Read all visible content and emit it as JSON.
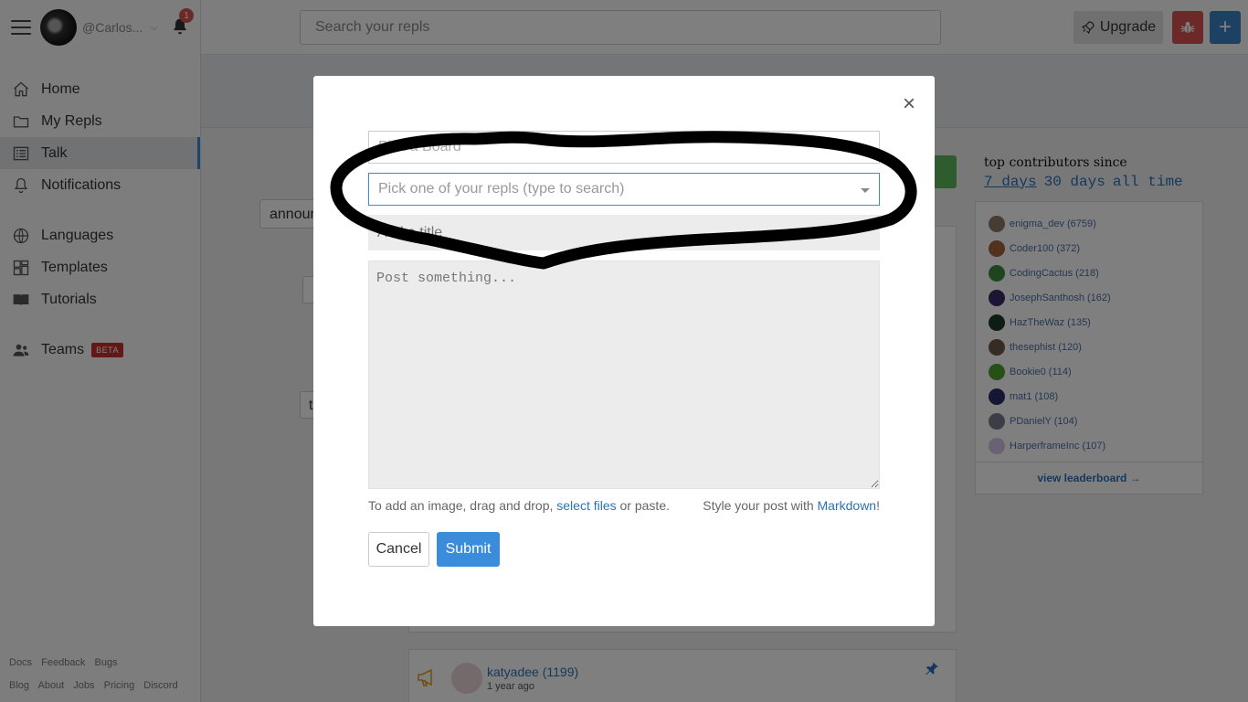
{
  "sidebar": {
    "username": "@Carlos...",
    "notification_count": "1",
    "items": [
      {
        "label": "Home",
        "icon": "home-icon"
      },
      {
        "label": "My Repls",
        "icon": "folder-icon"
      },
      {
        "label": "Talk",
        "icon": "talk-icon"
      },
      {
        "label": "Notifications",
        "icon": "bell-icon"
      },
      {
        "label": "Languages",
        "icon": "globe-icon"
      },
      {
        "label": "Templates",
        "icon": "templates-icon"
      },
      {
        "label": "Tutorials",
        "icon": "book-icon"
      },
      {
        "label": "Teams",
        "icon": "users-icon"
      }
    ],
    "beta_label": "BETA",
    "active_item": "Talk",
    "footer_links_row1": [
      "Docs",
      "Feedback",
      "Bugs"
    ],
    "footer_links_row2": [
      "Blog",
      "About",
      "Jobs",
      "Pricing",
      "Discord"
    ]
  },
  "header": {
    "search_placeholder": "Search your repls",
    "upgrade_label": "Upgrade"
  },
  "background": {
    "filter_label": "announ",
    "small_label_1": "t",
    "contributors": {
      "title": "top contributors since",
      "tabs": [
        "7 days",
        "30 days",
        "all time"
      ],
      "list": [
        {
          "label": "enigma_dev (6759)",
          "color": "#8a7a6a"
        },
        {
          "label": "Coder100 (372)",
          "color": "#a0643c"
        },
        {
          "label": "CodingCactus (218)",
          "color": "#3c8a3c"
        },
        {
          "label": "JosephSanthosh (162)",
          "color": "#3c2a6a"
        },
        {
          "label": "HazTheWaz (135)",
          "color": "#1a3a2a"
        },
        {
          "label": "thesephist (120)",
          "color": "#6a5a4a"
        },
        {
          "label": "Bookie0 (114)",
          "color": "#4ca02c"
        },
        {
          "label": "mat1 (108)",
          "color": "#2a2a6a"
        },
        {
          "label": "PDanielY (104)",
          "color": "#7a7a8a"
        },
        {
          "label": "HarperframeInc (107)",
          "color": "#d4c4e4"
        }
      ],
      "view_leaderboard": "view leaderboard →"
    },
    "post": {
      "user": "katyadee (1199)",
      "time": "1 year ago"
    }
  },
  "modal": {
    "board_placeholder": "Pick a Board",
    "repl_placeholder": "Pick one of your repls (type to search)",
    "title_placeholder": "Add a title",
    "body_placeholder": "Post something...",
    "help_prefix": "To add an image, drag and drop, ",
    "help_link": "select files",
    "help_suffix": " or paste.",
    "style_prefix": "Style your post with ",
    "style_link": "Markdown",
    "style_suffix": "!",
    "cancel_label": "Cancel",
    "submit_label": "Submit"
  },
  "colors": {
    "accent": "#3b8ddb",
    "danger": "#d9534f",
    "overlay": "rgba(0,0,0,0.5)"
  }
}
